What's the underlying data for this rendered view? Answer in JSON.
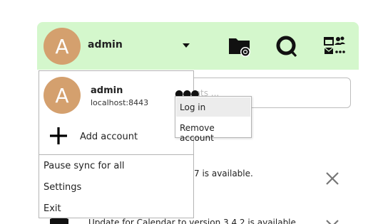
{
  "header": {
    "avatar_letter": "A",
    "username": "admin",
    "icons": [
      "folder-sync-icon",
      "talk-icon",
      "apps-icon"
    ]
  },
  "search": {
    "placeholder": "ents ..."
  },
  "updates": [
    {
      "text": "7 is available."
    },
    {
      "text": "Update for Calendar to version 3.4.2 is available."
    }
  ],
  "account_menu": {
    "account": {
      "avatar_letter": "A",
      "name": "admin",
      "server": "localhost:8443"
    },
    "add_account_label": "Add account",
    "items": [
      "Pause sync for all",
      "Settings",
      "Exit"
    ]
  },
  "context_menu": {
    "items": [
      "Log in",
      "Remove account"
    ]
  },
  "colors": {
    "header_bg": "#d4f7cc",
    "avatar_bg": "#d4a06e"
  }
}
